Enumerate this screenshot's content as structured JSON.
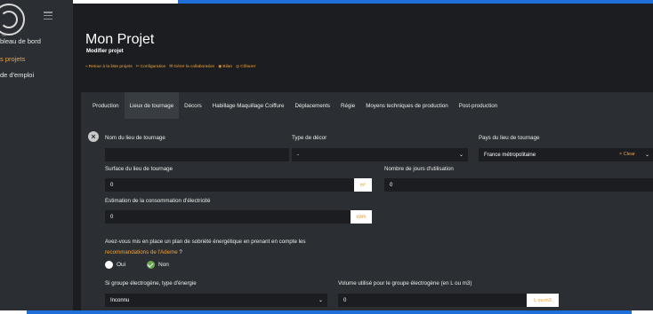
{
  "sidebar": {
    "sub_label": "Se",
    "items": [
      {
        "label": "bleau de bord",
        "active": false
      },
      {
        "label": "s projets",
        "active": true
      },
      {
        "label": "de d'emploi",
        "active": false
      }
    ]
  },
  "page": {
    "title": "Mon Projet",
    "subtitle": "Modifier projet",
    "actions": [
      {
        "icon": "back-arrow-icon",
        "glyph": "«",
        "label": "Retour à la liste projets"
      },
      {
        "icon": "configuration-icon",
        "glyph": "✂",
        "label": "Configuration"
      },
      {
        "icon": "collaboration-icon",
        "glyph": "✉",
        "label": "Gérer la collaboration"
      },
      {
        "icon": "bilan-icon",
        "glyph": "◉",
        "label": "Bilan"
      },
      {
        "icon": "cloturer-icon",
        "glyph": "◎",
        "label": "Clôturer"
      }
    ]
  },
  "tabs": [
    {
      "label": "Production",
      "active": false
    },
    {
      "label": "Lieux de tournage",
      "active": true
    },
    {
      "label": "Décors",
      "active": false
    },
    {
      "label": "Habillage Maquillage Coiffure",
      "active": false
    },
    {
      "label": "Déplacements",
      "active": false
    },
    {
      "label": "Régie",
      "active": false
    },
    {
      "label": "Moyens techniques de production",
      "active": false
    },
    {
      "label": "Post-production",
      "active": false
    }
  ],
  "form": {
    "nom_label": "Nom du lieu de tournage",
    "nom_value": "",
    "type_decor_label": "Type de décor",
    "type_decor_value": "-",
    "pays_label": "Pays du lieu de tournage",
    "pays_value": "France métropolitaine",
    "pays_clear": "× Clear",
    "surface_label": "Surface du lieu de tournage",
    "surface_value": "0",
    "surface_unit": "m²",
    "jours_label": "Nombre de jours d'utilisation",
    "jours_value": "0",
    "conso_label": "Estimation de la consommation d'électricité",
    "conso_value": "0",
    "conso_unit": "kWh",
    "question_line1": "Avez-vous mis en place un plan de sobriété énergétique en prenant en compte les",
    "question_link": "recommandations de l'Ademe",
    "question_mark": " ?",
    "radio_oui": "Oui",
    "radio_non": "Non",
    "groupe_label": "Si groupe électrogène, type d'énergie",
    "groupe_value": "Inconnu",
    "volume_label": "Volume utilisé pour le groupe électrogène (en L ou m3)",
    "volume_value": "0",
    "volume_unit": "L ou m3"
  }
}
